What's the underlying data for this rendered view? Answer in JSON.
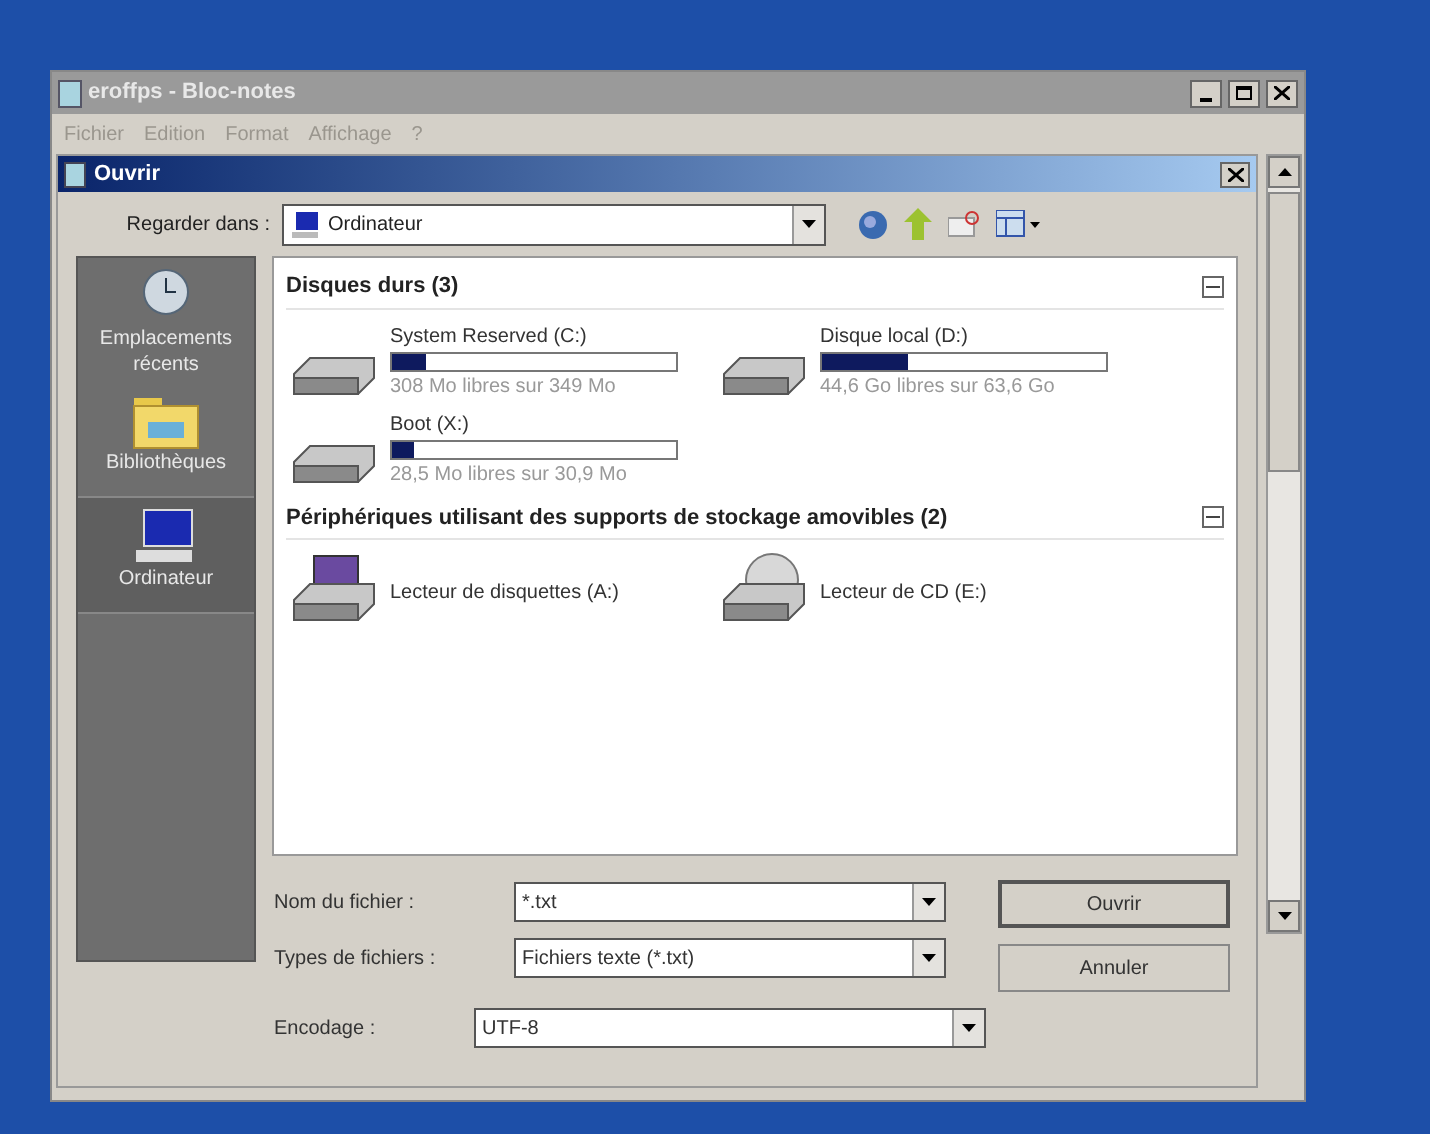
{
  "notepad": {
    "title": "eroffps - Bloc-notes",
    "menu": [
      "Fichier",
      "Edition",
      "Format",
      "Affichage",
      "?"
    ]
  },
  "dialog": {
    "title": "Ouvrir",
    "look_in_label": "Regarder dans :",
    "look_in_value": "Ordinateur"
  },
  "sidebar": {
    "items": [
      {
        "label": "Emplacements récents",
        "kind": "recent",
        "selected": false
      },
      {
        "label": "Bibliothèques",
        "kind": "libraries",
        "selected": false
      },
      {
        "label": "Ordinateur",
        "kind": "computer",
        "selected": true
      }
    ]
  },
  "groups": [
    {
      "title": "Disques durs (3)",
      "items": [
        {
          "kind": "disk",
          "name": "System Reserved (C:)",
          "level": 0.12,
          "info": "308 Mo libres sur 349 Mo"
        },
        {
          "kind": "disk",
          "name": "Disque local (D:)",
          "level": 0.3,
          "info": "44,6 Go libres sur 63,6 Go"
        },
        {
          "kind": "disk",
          "name": "Boot (X:)",
          "level": 0.08,
          "info": "28,5 Mo libres sur 30,9 Mo"
        }
      ]
    },
    {
      "title": "Périphériques utilisant des supports de stockage amovibles (2)",
      "items": [
        {
          "kind": "floppy",
          "name": "Lecteur de disquettes (A:)"
        },
        {
          "kind": "cd",
          "name": "Lecteur de CD (E:)"
        }
      ]
    }
  ],
  "fields": [
    {
      "label": "Nom du fichier :",
      "value": "*.txt"
    },
    {
      "label": "Types de fichiers :",
      "value": "Fichiers texte (*.txt)"
    }
  ],
  "encoding": {
    "label": "Encodage :",
    "value": "UTF-8"
  },
  "buttons": [
    "Ouvrir",
    "Annuler"
  ]
}
